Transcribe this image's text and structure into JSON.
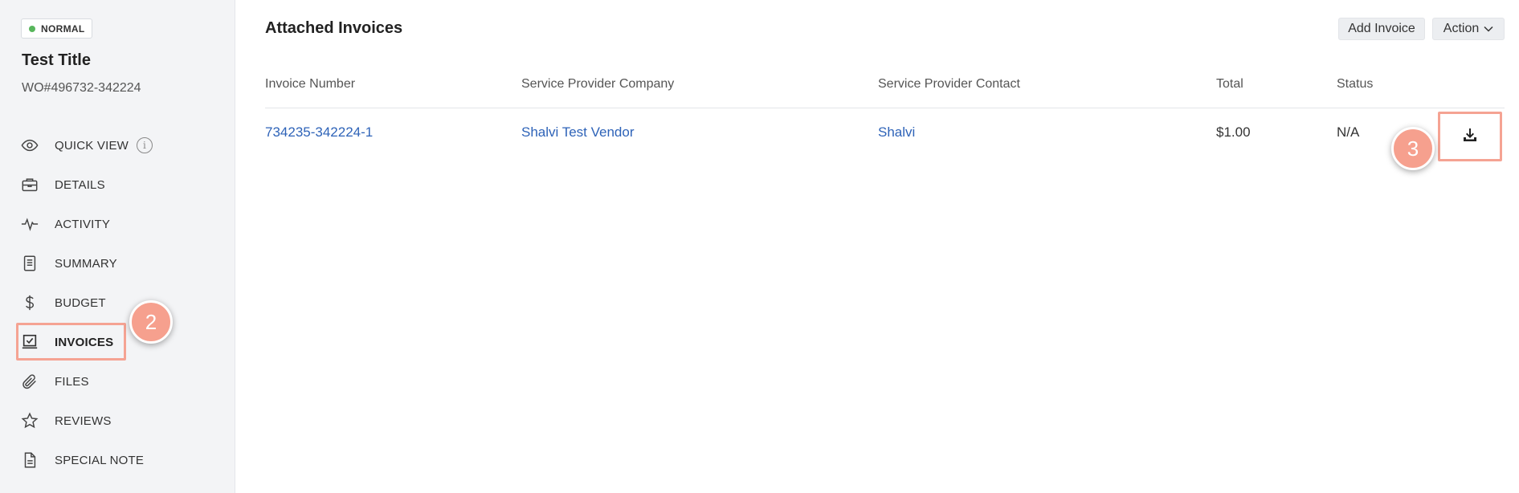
{
  "sidebar": {
    "badge": "NORMAL",
    "title": "Test Title",
    "wo_number": "WO#496732-342224",
    "items": [
      {
        "label": "QUICK VIEW",
        "icon": "eye-icon"
      },
      {
        "label": "DETAILS",
        "icon": "briefcase-icon"
      },
      {
        "label": "ACTIVITY",
        "icon": "activity-icon"
      },
      {
        "label": "SUMMARY",
        "icon": "document-icon"
      },
      {
        "label": "BUDGET",
        "icon": "dollar-icon"
      },
      {
        "label": "INVOICES",
        "icon": "invoice-icon"
      },
      {
        "label": "FILES",
        "icon": "paperclip-icon"
      },
      {
        "label": "REVIEWS",
        "icon": "star-icon"
      },
      {
        "label": "SPECIAL NOTE",
        "icon": "note-icon"
      }
    ],
    "info_glyph": "i"
  },
  "main": {
    "title": "Attached Invoices",
    "add_invoice_label": "Add Invoice",
    "action_label": "Action",
    "columns": [
      "Invoice Number",
      "Service Provider Company",
      "Service Provider Contact",
      "Total",
      "Status"
    ],
    "rows": [
      {
        "invoice_number": "734235-342224-1",
        "company": "Shalvi Test Vendor",
        "contact": "Shalvi",
        "total": "$1.00",
        "status": "N/A"
      }
    ]
  },
  "annotations": {
    "step2": "2",
    "step3": "3"
  },
  "colors": {
    "link": "#2e63b8",
    "highlight": "#f5a393",
    "badge_dot": "#58b65c"
  }
}
